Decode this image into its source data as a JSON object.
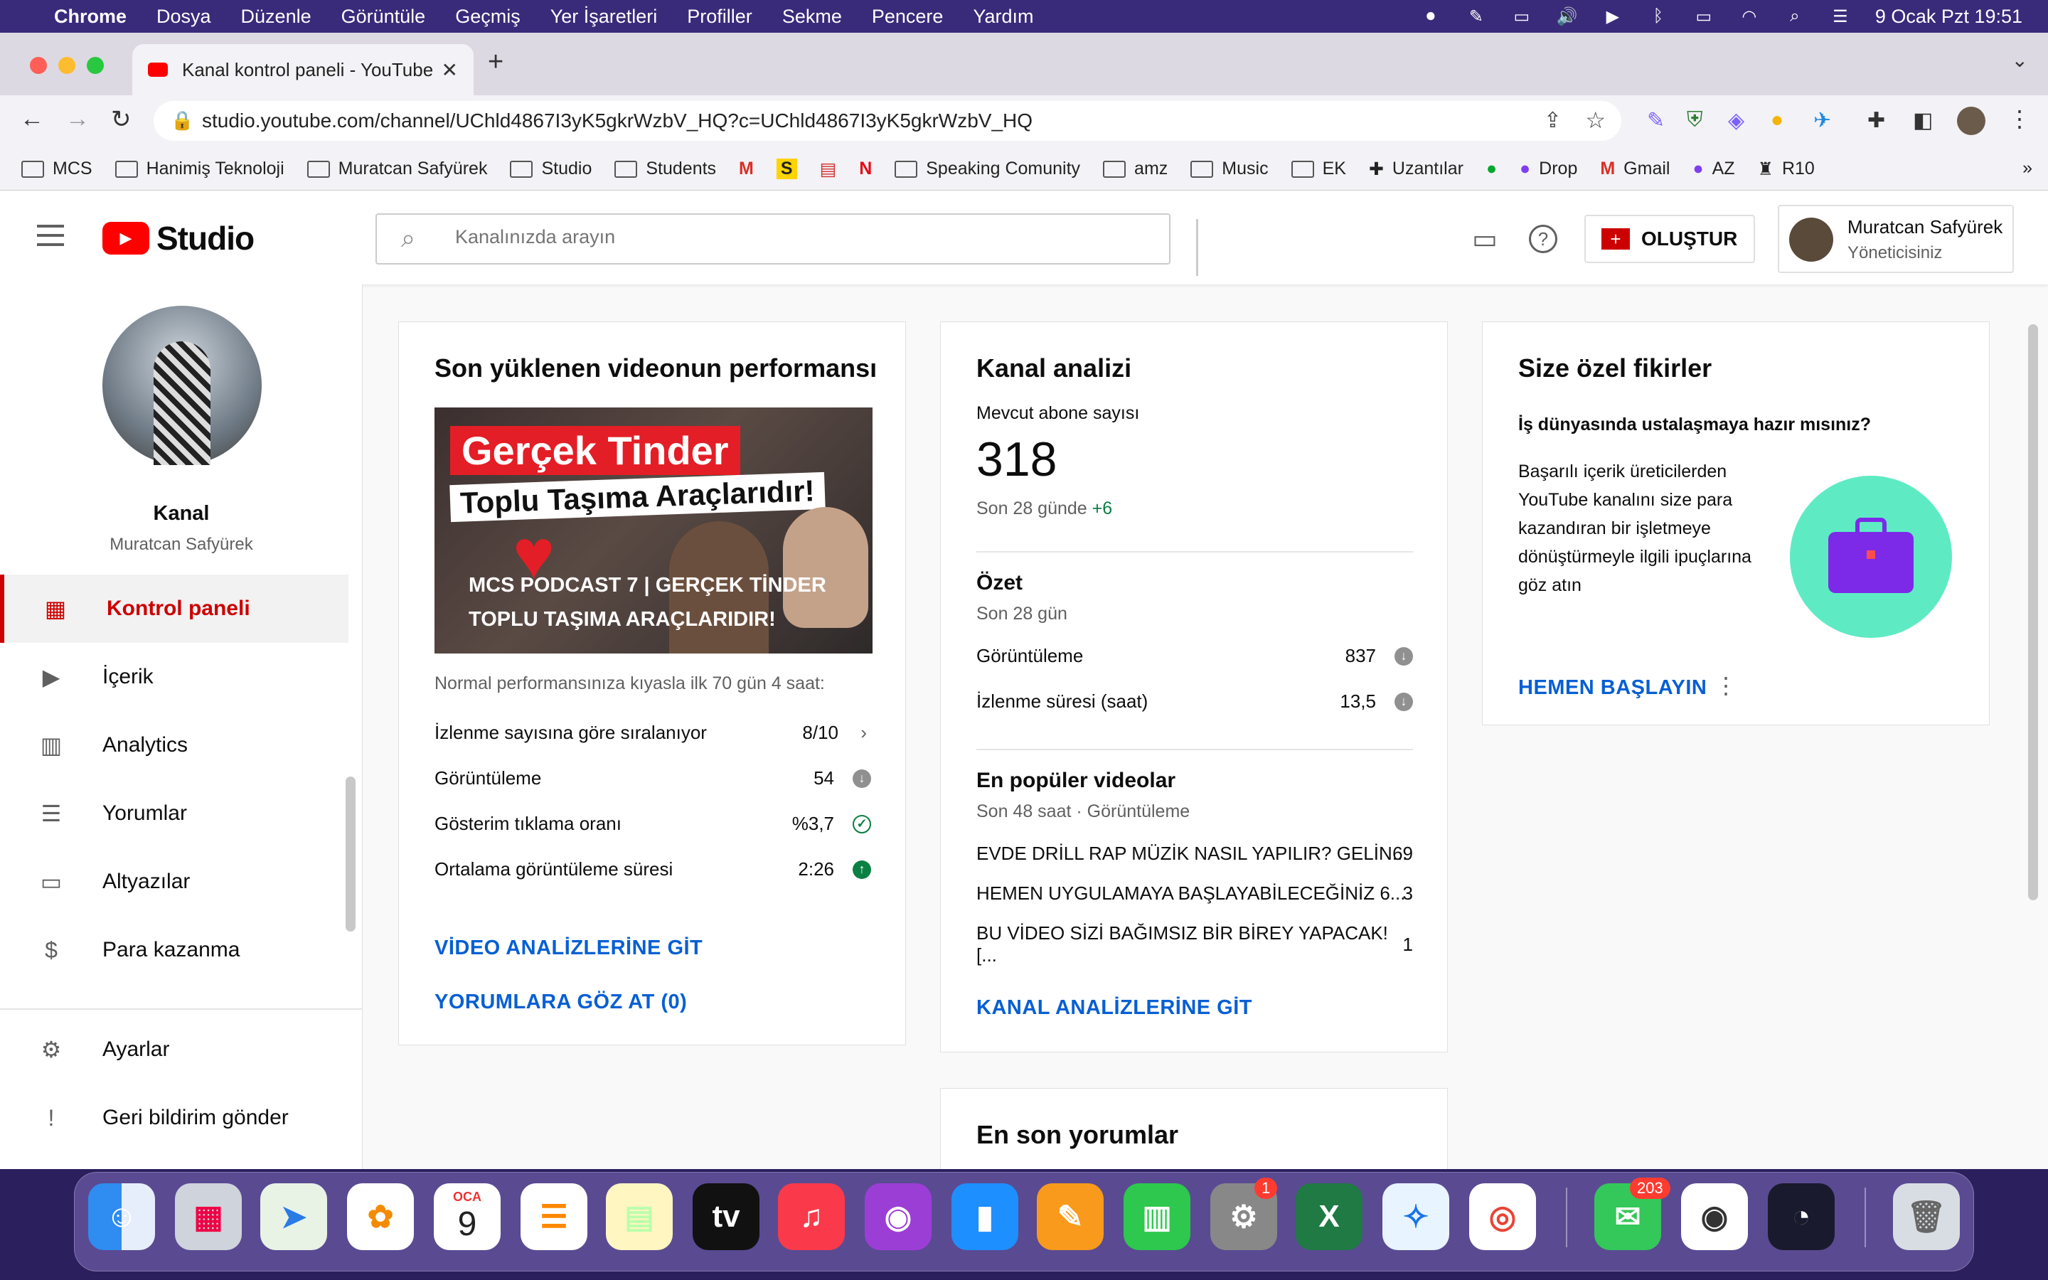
{
  "menubar": {
    "app": "Chrome",
    "items": [
      "Dosya",
      "Düzenle",
      "Görüntüle",
      "Geçmiş",
      "Yer İşaretleri",
      "Profiller",
      "Sekme",
      "Pencere",
      "Yardım"
    ],
    "datetime": "9 Ocak Pzt  19:51"
  },
  "browser": {
    "tab_title": "Kanal kontrol paneli - YouTube",
    "url": "studio.youtube.com/channel/UChld4867I3yK5gkrWzbV_HQ?c=UChld4867I3yK5gkrWzbV_HQ",
    "bookmarks": [
      "MCS",
      "Hanimiş Teknoloji",
      "Muratcan Safyürek",
      "Studio",
      "Students",
      "Speaking Comunity",
      "amz",
      "Music",
      "EK",
      "Uzantılar",
      "Drop",
      "Gmail",
      "AZ",
      "R10"
    ],
    "bookmark_chips": {
      "s": "S",
      "n": "N",
      "more": "»"
    }
  },
  "studio": {
    "logo": "Studio",
    "search_placeholder": "Kanalınızda arayın",
    "create_label": "OLUŞTUR",
    "account": {
      "name": "Muratcan Safyürek",
      "role": "Yöneticisiniz"
    },
    "sidebar": {
      "channel_label": "Kanal",
      "channel_name": "Muratcan Safyürek",
      "items": [
        {
          "label": "Kontrol paneli"
        },
        {
          "label": "İçerik"
        },
        {
          "label": "Analytics"
        },
        {
          "label": "Yorumlar"
        },
        {
          "label": "Altyazılar"
        },
        {
          "label": "Para kazanma"
        },
        {
          "label": "Ayarlar"
        },
        {
          "label": "Geri bildirim gönder"
        }
      ]
    },
    "perf": {
      "title": "Son yüklenen videonun performansı",
      "thumb": {
        "line1": "Gerçek Tinder",
        "line2": "Toplu Taşıma Araçlarıdır!",
        "caption1": "MCS PODCAST 7  |  GERÇEK TİNDER",
        "caption2": "TOPLU TAŞIMA ARAÇLARIDIR!"
      },
      "compare": "Normal performansınıza kıyasla ilk 70 gün 4 saat:",
      "rows": [
        {
          "label": "İzlenme sayısına göre sıralanıyor",
          "value": "8/10"
        },
        {
          "label": "Görüntüleme",
          "value": "54"
        },
        {
          "label": "Gösterim tıklama oranı",
          "value": "%3,7"
        },
        {
          "label": "Ortalama görüntüleme süresi",
          "value": "2:26"
        }
      ],
      "link1": "VİDEO ANALİZLERİNE GİT",
      "link2": "YORUMLARA GÖZ AT (0)"
    },
    "analytics": {
      "title": "Kanal analizi",
      "subs_label": "Mevcut abone sayısı",
      "subs": "318",
      "subs_change_label": "Son 28 günde",
      "subs_change": "+6",
      "summary_title": "Özet",
      "summary_period": "Son 28 gün",
      "summary_rows": [
        {
          "label": "Görüntüleme",
          "value": "837"
        },
        {
          "label": "İzlenme süresi (saat)",
          "value": "13,5"
        }
      ],
      "top_title": "En popüler videolar",
      "top_period": "Son 48 saat · Görüntüleme",
      "top_rows": [
        {
          "label": "EVDE DRİLL RAP MÜZİK NASIL YAPILIR? GELİN...",
          "value": "69"
        },
        {
          "label": "HEMEN UYGULAMAYA BAŞLAYABİLECEĞİNİZ 6...",
          "value": "3"
        },
        {
          "label": "BU VİDEO SİZİ BAĞIMSIZ BİR BİREY YAPACAK! [...",
          "value": "1"
        }
      ],
      "link": "KANAL ANALİZLERİNE GİT"
    },
    "ideas": {
      "title": "Size özel fikirler",
      "question": "İş dünyasında ustalaşmaya hazır mısınız?",
      "body": "Başarılı içerik üreticilerden YouTube kanalını size para kazandıran bir işletmeye dönüştürmeyle ilgili ipuçlarına göz atın",
      "link": "HEMEN BAŞLAYIN"
    },
    "comments": {
      "title": "En son yorumlar"
    }
  },
  "dock": {
    "calendar_month": "OCA",
    "calendar_day": "9",
    "settings_badge": "1",
    "messages_badge": "203"
  },
  "colors": {
    "accent_red": "#cc0000",
    "link_blue": "#065fd4",
    "green": "#0b8043"
  }
}
